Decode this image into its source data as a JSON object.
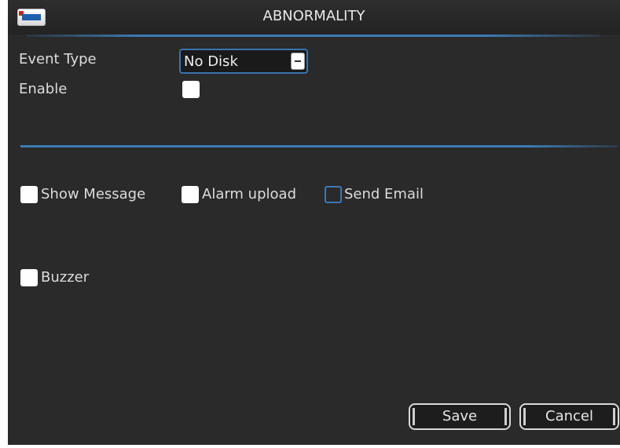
{
  "window": {
    "title": "ABNORMALITY"
  },
  "form": {
    "event_type_label": "Event Type",
    "event_type_value": "No Disk",
    "enable_label": "Enable",
    "enable_checked": false
  },
  "actions": {
    "show_message_label": "Show Message",
    "show_message_checked": false,
    "alarm_upload_label": "Alarm upload",
    "alarm_upload_checked": false,
    "send_email_label": "Send Email",
    "send_email_checked": false,
    "buzzer_label": "Buzzer",
    "buzzer_checked": false
  },
  "buttons": {
    "save_label": "Save",
    "cancel_label": "Cancel"
  },
  "colors": {
    "background": "#2a2a2a",
    "accent": "#3c7cb6",
    "text": "#dcdcdc"
  }
}
